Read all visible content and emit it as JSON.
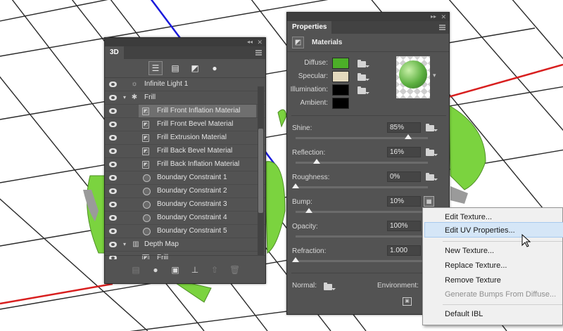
{
  "colors": {
    "panel_bg": "#535353",
    "diffuse": "#4caf28",
    "specular": "#e3d9bd",
    "illumination": "#000000",
    "ambient": "#000000",
    "axis_red": "#d81f1f",
    "axis_blue": "#1a1adc",
    "grid_line": "#2a2a2a",
    "menu_bg": "#f0f0f0",
    "menu_highlight": "#d5e6f7"
  },
  "panel_3d": {
    "tab": "3D",
    "toolbar_icons": [
      "scene-filter-icon",
      "mesh-filter-icon",
      "material-filter-icon",
      "light-filter-icon"
    ],
    "layers": [
      {
        "label": "Infinite Light 1",
        "eye": true,
        "icon": "infinite-light-icon",
        "kind": "light"
      },
      {
        "label": "Frill",
        "eye": true,
        "icon": "mesh-icon",
        "kind": "mesh",
        "expanded": true
      },
      {
        "label": "Frill Front Inflation Material",
        "eye": true,
        "icon": "material-icon",
        "kind": "material",
        "selected": true
      },
      {
        "label": "Frill Front Bevel Material",
        "eye": true,
        "icon": "material-icon",
        "kind": "material"
      },
      {
        "label": "Frill Extrusion Material",
        "eye": true,
        "icon": "material-icon",
        "kind": "material"
      },
      {
        "label": "Frill Back Bevel Material",
        "eye": true,
        "icon": "material-icon",
        "kind": "material"
      },
      {
        "label": "Frill Back Inflation Material",
        "eye": true,
        "icon": "material-icon",
        "kind": "material"
      },
      {
        "label": "Boundary Constraint 1",
        "eye": true,
        "icon": "constraint-icon",
        "kind": "constraint"
      },
      {
        "label": "Boundary Constraint 2",
        "eye": true,
        "icon": "constraint-icon",
        "kind": "constraint"
      },
      {
        "label": "Boundary Constraint 3",
        "eye": true,
        "icon": "constraint-icon",
        "kind": "constraint"
      },
      {
        "label": "Boundary Constraint 4",
        "eye": true,
        "icon": "constraint-icon",
        "kind": "constraint"
      },
      {
        "label": "Boundary Constraint 5",
        "eye": true,
        "icon": "constraint-icon",
        "kind": "constraint"
      },
      {
        "label": "Depth Map",
        "eye": true,
        "icon": "depth-map-icon",
        "kind": "group",
        "expanded": true
      },
      {
        "label": "Frill",
        "eye": true,
        "icon": "material-icon",
        "kind": "material"
      }
    ],
    "bottom_icons": [
      "delete-disabled-icon",
      "light-add-icon",
      "render-icon",
      "ground-plane-icon",
      "move-icon",
      "trash-icon"
    ]
  },
  "panel_props": {
    "tab": "Properties",
    "section": "Materials",
    "fields": {
      "diffuse": "Diffuse:",
      "specular": "Specular:",
      "illumination": "Illumination:",
      "ambient": "Ambient:"
    },
    "sliders": [
      {
        "label": "Shine:",
        "value": "85%",
        "level": 0.85,
        "folder": true
      },
      {
        "label": "Reflection:",
        "value": "16%",
        "level": 0.16,
        "folder": true
      },
      {
        "label": "Roughness:",
        "value": "0%",
        "level": 0.0,
        "folder": true
      },
      {
        "label": "Bump:",
        "value": "10%",
        "level": 0.1,
        "folder": false,
        "bump_button": true
      },
      {
        "label": "Opacity:",
        "value": "100%",
        "level": 1.0,
        "folder": false
      },
      {
        "label": "Refraction:",
        "value": "1.000",
        "level": 0.0,
        "folder": false
      }
    ],
    "normal_label": "Normal:",
    "environment_label": "Environment:"
  },
  "context_menu": {
    "items": [
      {
        "label": "Edit Texture...",
        "disabled": false
      },
      {
        "label": "Edit UV Properties...",
        "disabled": false,
        "hover": true
      },
      {
        "label": "New Texture...",
        "disabled": false
      },
      {
        "label": "Replace Texture...",
        "disabled": false
      },
      {
        "label": "Remove Texture",
        "disabled": false
      },
      {
        "label": "Generate Bumps From Diffuse...",
        "disabled": true
      },
      {
        "label": "Default IBL",
        "disabled": false
      }
    ]
  }
}
